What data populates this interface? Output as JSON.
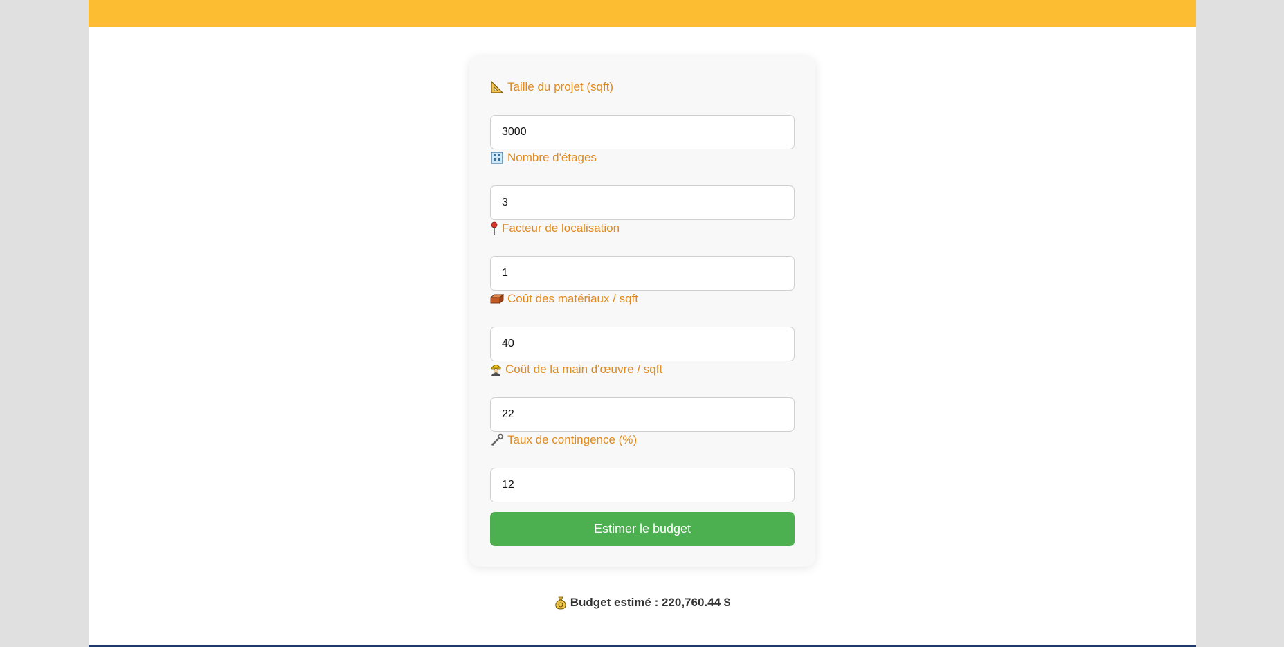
{
  "colors": {
    "topbar": "#fdbd33",
    "label": "#e08a1e",
    "button": "#4caf50",
    "background": "#e0e0e0",
    "bottom_line": "#1f3a6b"
  },
  "form": {
    "fields": [
      {
        "icon": "triangular-ruler-icon",
        "label": "Taille du projet (sqft)",
        "value": "3000"
      },
      {
        "icon": "office-building-icon",
        "label": "Nombre d'étages",
        "value": "3"
      },
      {
        "icon": "round-pushpin-icon",
        "label": "Facteur de localisation",
        "value": "1"
      },
      {
        "icon": "brick-icon",
        "label": "Coût des matériaux / sqft",
        "value": "40"
      },
      {
        "icon": "construction-worker-icon",
        "label": "Coût de la main d'œuvre / sqft",
        "value": "22"
      },
      {
        "icon": "wrench-icon",
        "label": "Taux de contingence (%)",
        "value": "12"
      }
    ],
    "submit_label": "Estimer le budget"
  },
  "result": {
    "icon": "money-bag-icon",
    "text": "Budget estimé : 220,760.44 $"
  }
}
